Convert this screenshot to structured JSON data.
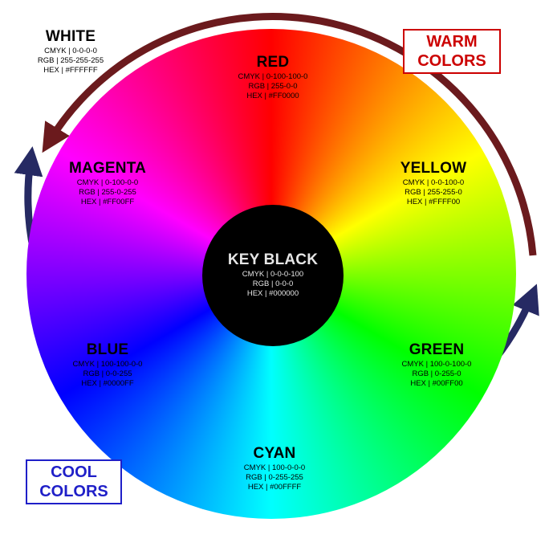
{
  "colors": {
    "warm_arrow": "#6b1a1d",
    "cool_arrow": "#262a63",
    "warm_box": "#cc0000",
    "cool_box": "#1f1fc8"
  },
  "labels": {
    "white": {
      "name": "WHITE",
      "cmyk": "CMYK | 0-0-0-0",
      "rgb": "RGB | 255-255-255",
      "hex": "HEX | #FFFFFF"
    },
    "red": {
      "name": "RED",
      "cmyk": "CMYK | 0-100-100-0",
      "rgb": "RGB | 255-0-0",
      "hex": "HEX | #FF0000"
    },
    "yellow": {
      "name": "YELLOW",
      "cmyk": "CMYK | 0-0-100-0",
      "rgb": "RGB | 255-255-0",
      "hex": "HEX | #FFFF00"
    },
    "magenta": {
      "name": "MAGENTA",
      "cmyk": "CMYK | 0-100-0-0",
      "rgb": "RGB | 255-0-255",
      "hex": "HEX | #FF00FF"
    },
    "key": {
      "name": "KEY BLACK",
      "cmyk": "CMYK | 0-0-0-100",
      "rgb": "RGB | 0-0-0",
      "hex": "HEX | #000000"
    },
    "blue": {
      "name": "BLUE",
      "cmyk": "CMYK | 100-100-0-0",
      "rgb": "RGB | 0-0-255",
      "hex": "HEX | #0000FF"
    },
    "green": {
      "name": "GREEN",
      "cmyk": "CMYK | 100-0-100-0",
      "rgb": "RGB | 0-255-0",
      "hex": "HEX | #00FF00"
    },
    "cyan": {
      "name": "CYAN",
      "cmyk": "CMYK | 100-0-0-0",
      "rgb": "RGB | 0-255-255",
      "hex": "HEX | #00FFFF"
    }
  },
  "warm_tag": {
    "line1": "WARM",
    "line2": "COLORS"
  },
  "cool_tag": {
    "line1": "COOL",
    "line2": "COLORS"
  }
}
